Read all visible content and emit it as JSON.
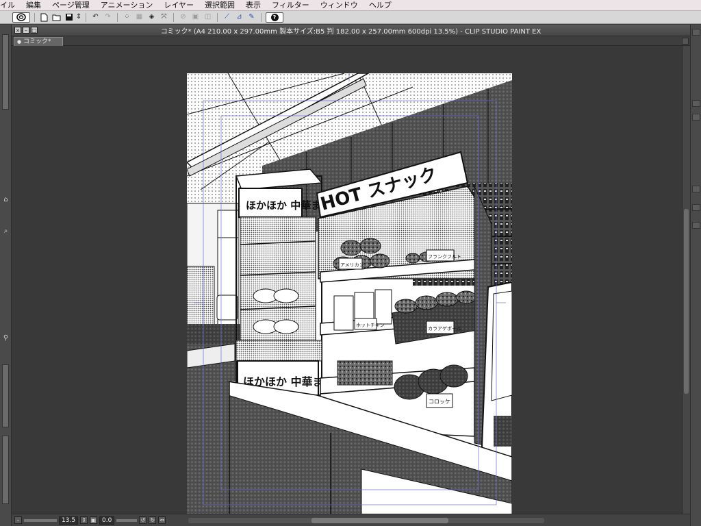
{
  "menu": [
    "イル",
    "編集",
    "ページ管理",
    "アニメーション",
    "レイヤー",
    "選択範囲",
    "表示",
    "フィルター",
    "ウィンドウ",
    "ヘルプ"
  ],
  "window": {
    "title": "コミック* (A4 210.00 x 297.00mm 製本サイズ:B5 判 182.00 x 257.00mm 600dpi 13.5%)  - CLIP STUDIO PAINT EX",
    "tab_label": "コミック*"
  },
  "status": {
    "zoom": "13.5",
    "angle": "0.0"
  },
  "artwork": {
    "main_sign": "HOT スナック",
    "warmer_sign": "ほかほか 中華まん",
    "price_tags": [
      "アメリカン",
      "フランクフルト",
      "ホットチキン",
      "カラアゲボール",
      "コロッケ"
    ]
  },
  "icons": [
    "app-logo-icon",
    "new-file-icon",
    "open-file-icon",
    "save-icon",
    "undo-icon",
    "redo-icon",
    "transform-icon",
    "fill-icon",
    "pen-icon",
    "help-icon"
  ]
}
